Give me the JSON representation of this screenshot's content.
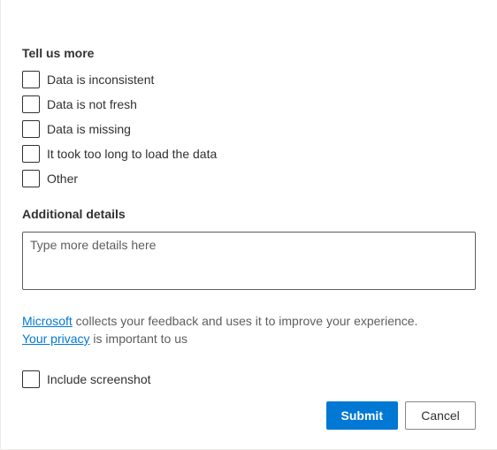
{
  "tell_us_more": {
    "title": "Tell us more",
    "options": [
      {
        "label": "Data is inconsistent"
      },
      {
        "label": "Data is not fresh"
      },
      {
        "label": "Data is missing"
      },
      {
        "label": "It took too long to load the data"
      },
      {
        "label": "Other"
      }
    ]
  },
  "additional_details": {
    "title": "Additional details",
    "placeholder": "Type more details here",
    "value": ""
  },
  "info": {
    "link1_text": "Microsoft",
    "text1": " collects your feedback and uses it to improve your experience. ",
    "link2_text": "Your privacy",
    "text2": " is important to us"
  },
  "include_screenshot": {
    "label": "Include screenshot"
  },
  "buttons": {
    "submit": "Submit",
    "cancel": "Cancel"
  }
}
